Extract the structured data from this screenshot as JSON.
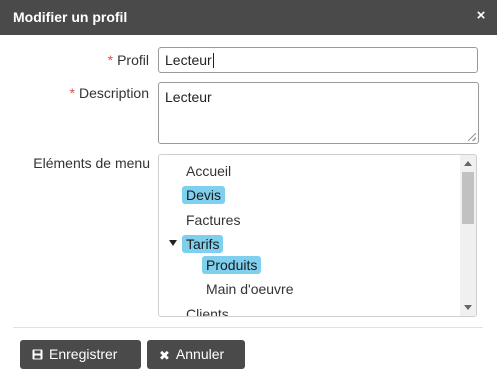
{
  "dialog": {
    "title": "Modifier un profil",
    "close_glyph": "×"
  },
  "form": {
    "required_marker": "*",
    "profil_label": "Profil",
    "profil_value": "Lecteur",
    "description_label": "Description",
    "description_value": "Lecteur",
    "menu_label": "Eléments de menu"
  },
  "tree": {
    "items": [
      {
        "label": "Accueil",
        "selected": false
      },
      {
        "label": "Devis",
        "selected": true
      },
      {
        "label": "Factures",
        "selected": false
      },
      {
        "label": "Tarifs",
        "selected": true,
        "expanded": true
      },
      {
        "label": "Produits",
        "selected": true
      },
      {
        "label": "Main d'oeuvre",
        "selected": false
      },
      {
        "label": "Clients",
        "selected": false
      }
    ]
  },
  "buttons": {
    "save_label": "Enregistrer",
    "save_icon": "floppy-disk-icon",
    "cancel_label": "Annuler",
    "cancel_icon": "close-icon"
  },
  "colors": {
    "titlebar": "#4a4a4a",
    "selection": "#7fd0ee",
    "required": "#d9534f",
    "button": "#4a4a4a"
  }
}
